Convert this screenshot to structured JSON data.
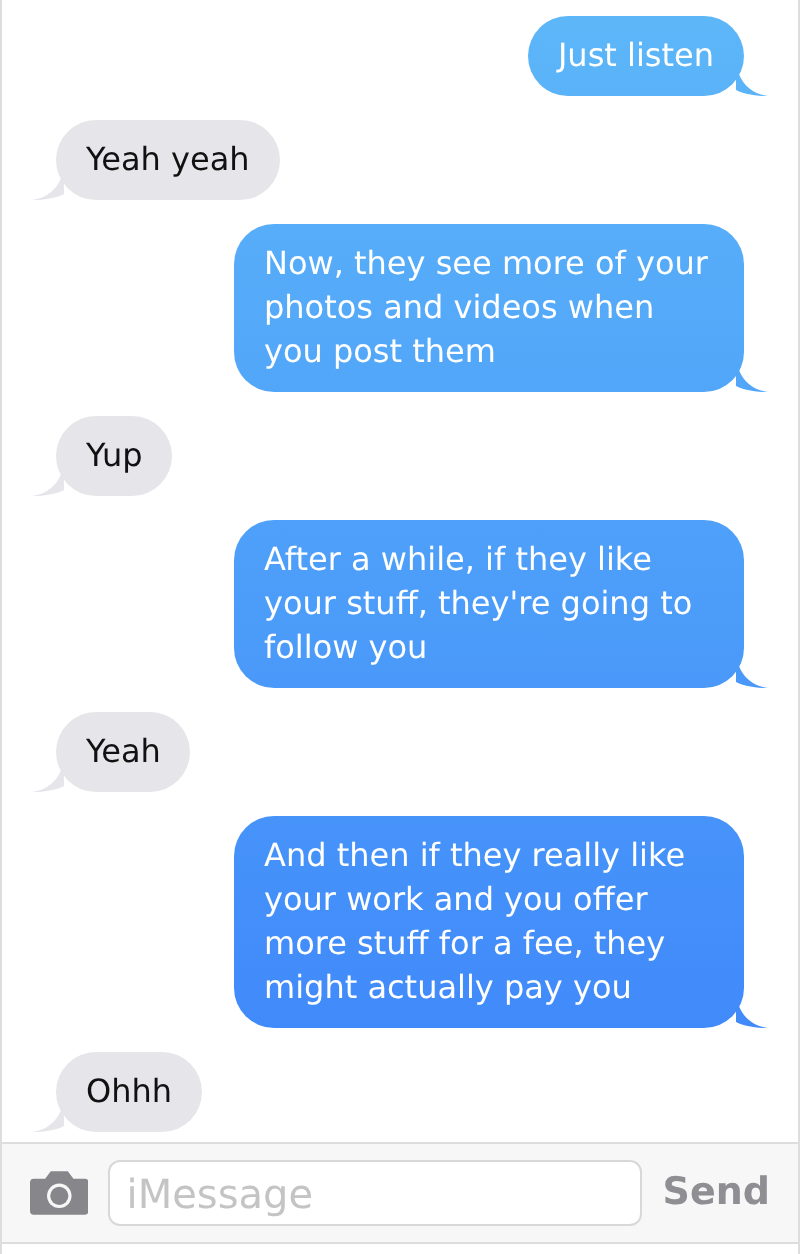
{
  "messages": [
    {
      "kind": "sent",
      "text": "Just listen"
    },
    {
      "kind": "received",
      "text": "Yeah yeah"
    },
    {
      "kind": "sent",
      "text": "Now, they see more of your photos and videos when you post them"
    },
    {
      "kind": "received",
      "text": "Yup"
    },
    {
      "kind": "sent",
      "text": "After a while, if they like your stuff, they're going to follow you"
    },
    {
      "kind": "received",
      "text": "Yeah"
    },
    {
      "kind": "sent",
      "text": "And then if they really like your work and you offer more stuff for a fee, they might actually pay you"
    },
    {
      "kind": "received",
      "text": "Ohhh"
    }
  ],
  "composer": {
    "placeholder": "iMessage",
    "send": "Send"
  }
}
